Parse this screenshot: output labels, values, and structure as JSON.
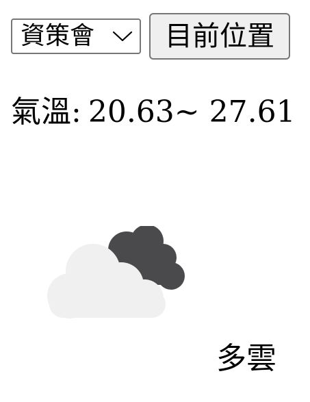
{
  "location_select": {
    "selected": "資策會",
    "icon": "chevron-down-icon"
  },
  "current_location_button": {
    "label": "目前位置"
  },
  "temperature": {
    "label": "氣溫",
    "separator": ":",
    "range": "20.63~ 27.61"
  },
  "weather": {
    "icon": "cloudy-icon",
    "condition": "多雲",
    "colors": {
      "front_cloud": "#f0f0f0",
      "back_cloud": "#4a4a4d"
    }
  }
}
